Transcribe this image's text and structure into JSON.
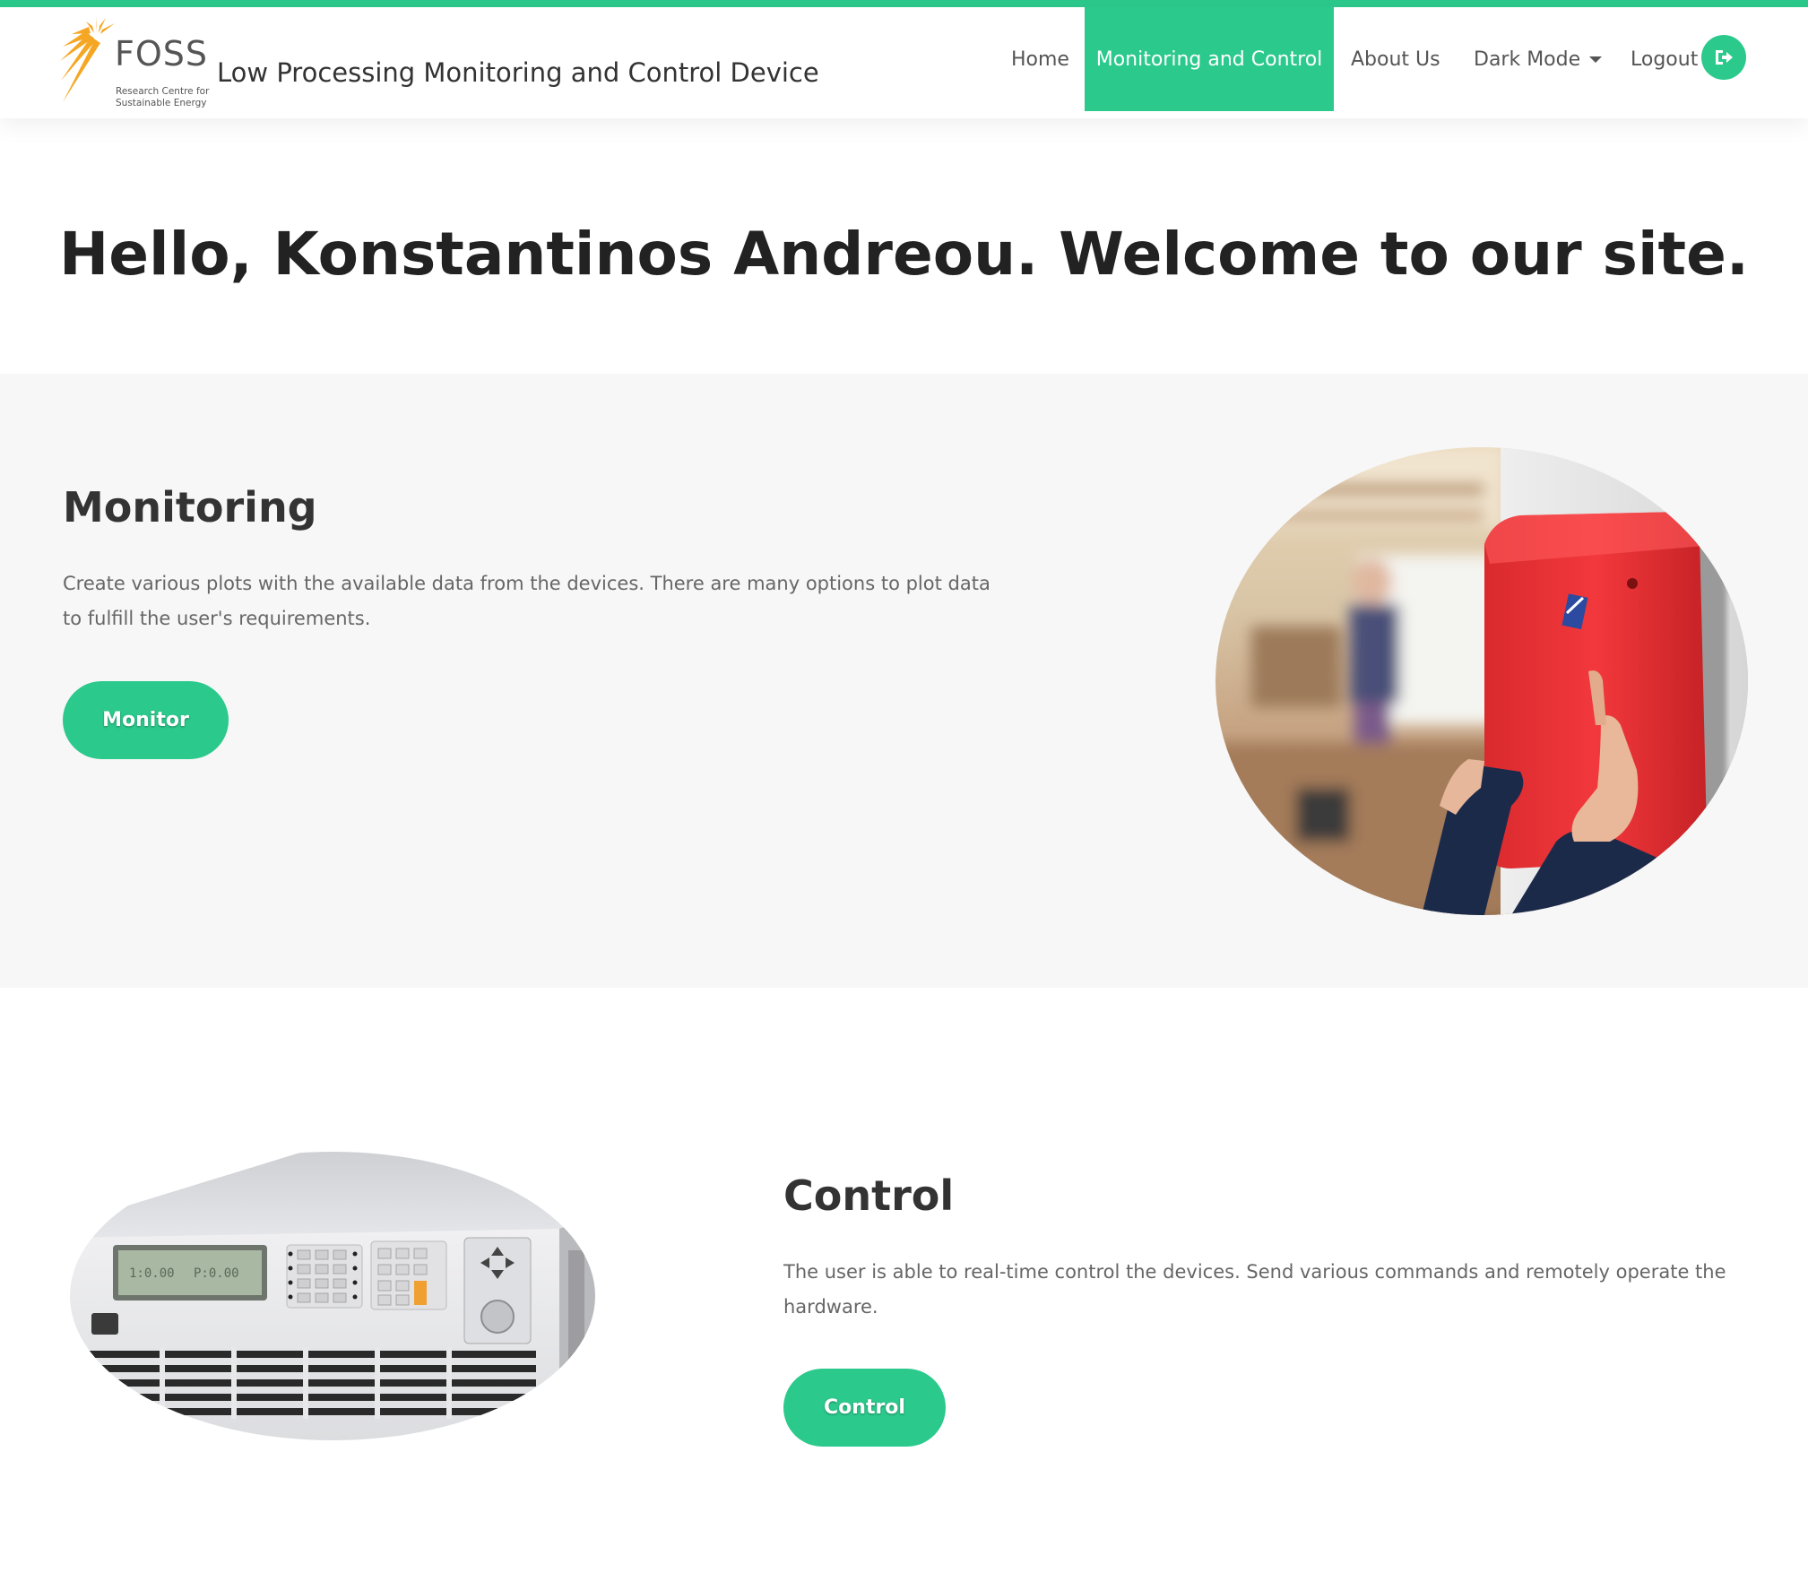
{
  "brand": {
    "logo_word": "FOSS",
    "logo_sub": "Research Centre for Sustainable Energy",
    "title": "Low Processing Monitoring and Control Device"
  },
  "nav": {
    "home": "Home",
    "monitoring_control": "Monitoring and Control",
    "about": "About Us",
    "dark_mode": "Dark Mode",
    "logout": "Logout"
  },
  "hero": {
    "greeting": "Hello, Konstantinos Andreou. Welcome to our site."
  },
  "monitoring": {
    "heading": "Monitoring",
    "text": "Create various plots with the available data from the devices. There are many options to plot data to fulfill the user's requirements.",
    "button": "Monitor"
  },
  "control": {
    "heading": "Control",
    "text": "The user is able to real-time control the devices. Send various commands and remotely operate the hardware.",
    "button": "Control"
  },
  "colors": {
    "accent": "#2bc98c",
    "logo_orange": "#f5a623",
    "section_bg": "#f7f7f7"
  }
}
